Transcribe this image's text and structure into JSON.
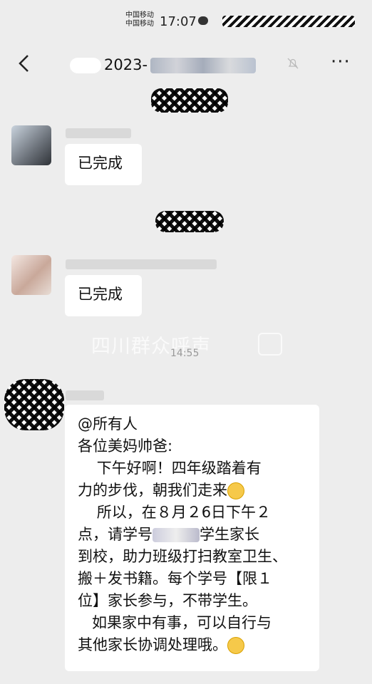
{
  "status": {
    "carrier_1": "中国移动",
    "carrier_2": "中国移动",
    "time": "17:07"
  },
  "header": {
    "title_visible": "2023-",
    "back_icon": "chevron-left-icon",
    "mute_icon": "bell-muted-icon",
    "more_icon": "more-dots-icon",
    "more_label": "···"
  },
  "messages": [
    {
      "text": "已完成"
    },
    {
      "text": "已完成"
    }
  ],
  "timestamp_3": "14:55",
  "watermark": "四川群众呼声",
  "announcement": {
    "mention": "@所有人",
    "greeting": "各位美妈帅爸:",
    "line1": "    下午好啊！四年级踏着有",
    "line2": "力的步伐，朝我们走来",
    "line3": "    所以，在８月２6日下午２",
    "line4a": "点，请学号",
    "line4b": "学生家长",
    "line5": "到校，助力班级打扫教室卫生、",
    "line6": "搬＋发书籍。每个学号【限１",
    "line7": "位】家长参与，不带学生。",
    "line8": "   如果家中有事，可以自行与",
    "line9": "其他家长协调处理哦。"
  }
}
